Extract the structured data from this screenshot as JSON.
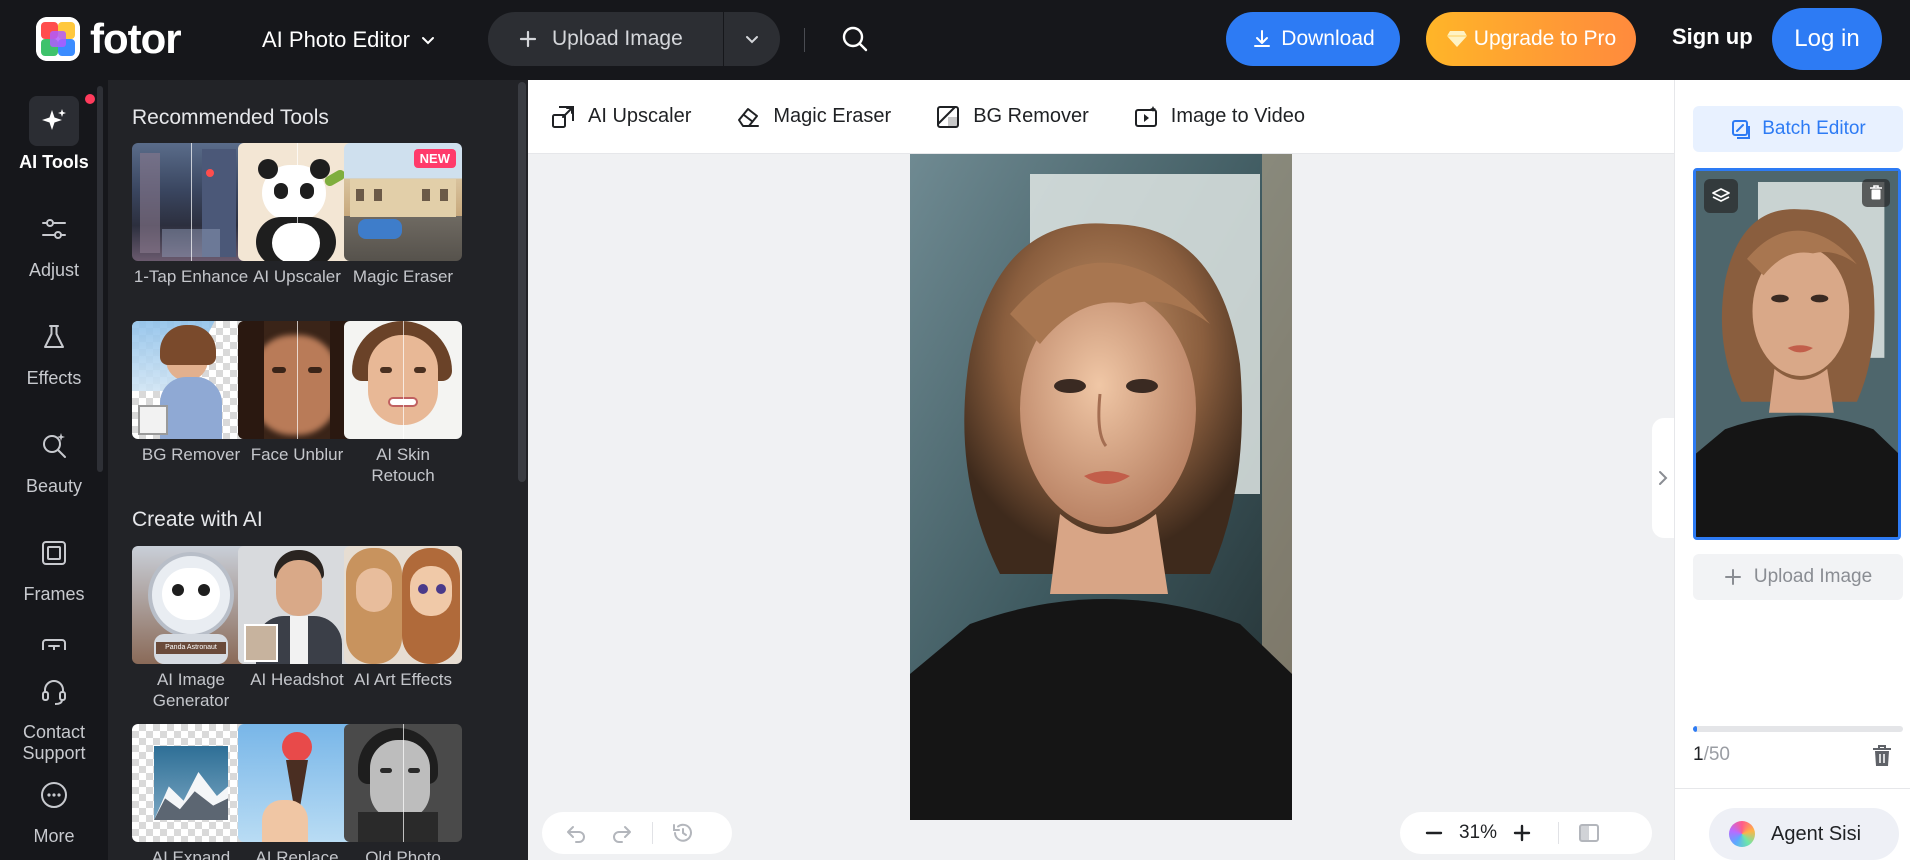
{
  "topbar": {
    "logo_text": "fotor",
    "editor_select": "AI Photo Editor",
    "upload_label": "Upload Image",
    "download_label": "Download",
    "upgrade_label": "Upgrade to Pro",
    "signup_label": "Sign up",
    "login_label": "Log in"
  },
  "rail": {
    "items": [
      {
        "label": "AI Tools",
        "icon": "sparkle-icon",
        "active": true
      },
      {
        "label": "Adjust",
        "icon": "sliders-icon"
      },
      {
        "label": "Effects",
        "icon": "flask-icon"
      },
      {
        "label": "Beauty",
        "icon": "beauty-icon"
      },
      {
        "label": "Frames",
        "icon": "frame-icon"
      },
      {
        "label": "Contact\nSupport",
        "icon": "headset-icon"
      },
      {
        "label": "More",
        "icon": "more-icon"
      }
    ],
    "contact_line1": "Contact",
    "contact_line2": "Support"
  },
  "panel": {
    "recommended_title": "Recommended Tools",
    "create_title": "Create with AI",
    "recommended": [
      {
        "label": "1-Tap Enhance"
      },
      {
        "label": "AI Upscaler"
      },
      {
        "label": "Magic Eraser",
        "badge": "NEW"
      },
      {
        "label": "BG Remover"
      },
      {
        "label": "Face Unblur"
      },
      {
        "label": "AI Skin Retouch"
      }
    ],
    "create": [
      {
        "label": "AI Image Generator",
        "thumb_text": "Panda Astronaut"
      },
      {
        "label": "AI Headshot"
      },
      {
        "label": "AI Art Effects"
      },
      {
        "label": "AI Expand"
      },
      {
        "label": "AI Replace"
      },
      {
        "label": "Old Photo"
      }
    ]
  },
  "toolbar": {
    "items": [
      {
        "label": "AI Upscaler",
        "icon": "upscale-icon"
      },
      {
        "label": "Magic Eraser",
        "icon": "eraser-icon"
      },
      {
        "label": "BG Remover",
        "icon": "bg-remove-icon"
      },
      {
        "label": "Image to Video",
        "icon": "video-icon"
      }
    ]
  },
  "canvas": {
    "zoom": "31%"
  },
  "rsidebar": {
    "batch_label": "Batch Editor",
    "upload_label": "Upload Image",
    "count_current": "1",
    "count_max": "/50",
    "progress": 0.02,
    "agent_label": "Agent Sisi"
  },
  "colors": {
    "accent": "#2d7bf4",
    "dark_bg": "#16171b",
    "panel_bg": "#222327",
    "canvas_bg": "#f0f1f3",
    "upgrade_start": "#ffb528",
    "upgrade_end": "#ff8a3d",
    "badge_new": "#ff3b6b"
  }
}
